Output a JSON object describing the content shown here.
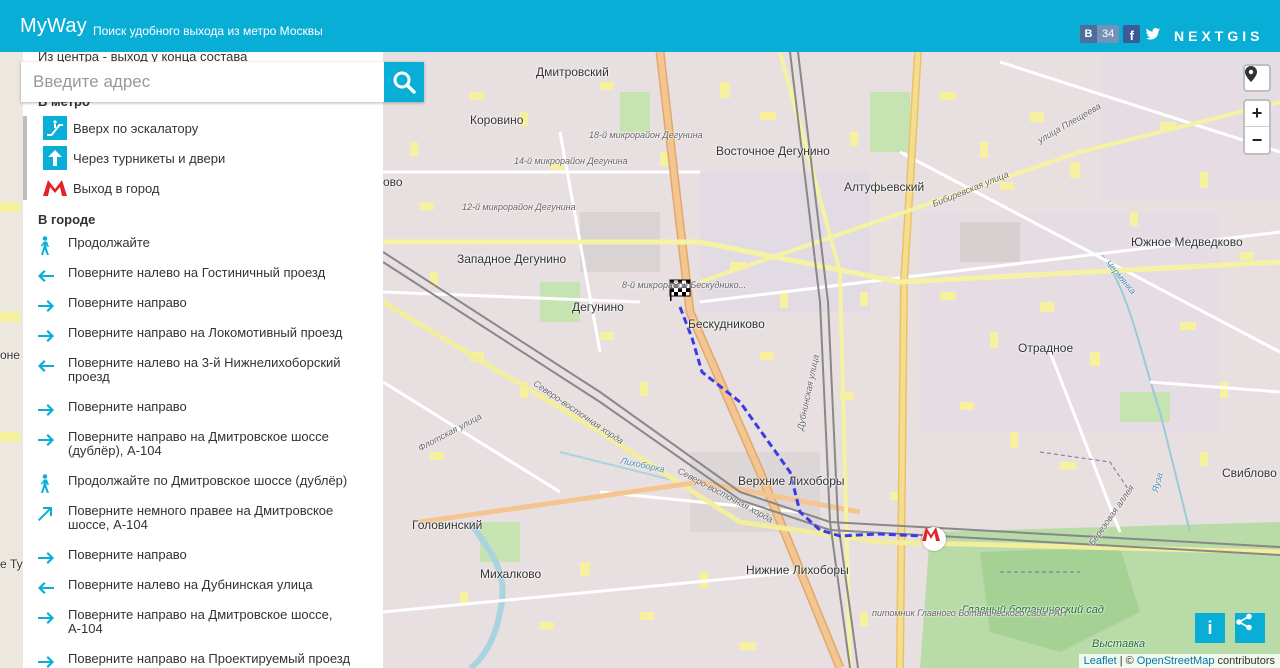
{
  "header": {
    "app_name": "MyWay",
    "tagline": "Поиск удобного выхода из метро Москвы",
    "vk_label": "В",
    "vk_count": "34",
    "fb_label": "f",
    "brand": "NEXTGIS"
  },
  "search": {
    "placeholder": "Введите адрес"
  },
  "sidebar": {
    "top_line": "Из центра - выход у конца состава",
    "metro_section_title": "В метро",
    "metro_steps": [
      {
        "label": "Вверх по эскалатору",
        "icon": "escalator-up-icon"
      },
      {
        "label": "Через турникеты и двери",
        "icon": "arrow-up-icon"
      },
      {
        "label": "Выход в город",
        "icon": "metro-logo-icon"
      }
    ],
    "city_section_title": "В городе",
    "city_steps": [
      {
        "label": "Продолжайте",
        "icon": "pedestrian-icon"
      },
      {
        "label": "Поверните налево на Гостиничный проезд",
        "icon": "arrow-left-icon"
      },
      {
        "label": "Поверните направо",
        "icon": "arrow-right-icon"
      },
      {
        "label": "Поверните направо на Локомотивный проезд",
        "icon": "arrow-right-icon"
      },
      {
        "label": "Поверните налево на 3-й Нижнелихоборский проезд",
        "icon": "arrow-left-icon"
      },
      {
        "label": "Поверните направо",
        "icon": "arrow-right-icon"
      },
      {
        "label": "Поверните направо на Дмитровское шоссе (дублёр), А-104",
        "icon": "arrow-right-icon"
      },
      {
        "label": "Продолжайте по Дмитровское шоссе (дублёр)",
        "icon": "pedestrian-icon"
      },
      {
        "label": "Поверните немного правее на Дмитровское шоссе, А-104",
        "icon": "arrow-slight-right-icon"
      },
      {
        "label": "Поверните направо",
        "icon": "arrow-right-icon"
      },
      {
        "label": "Поверните налево на Дубнинская улица",
        "icon": "arrow-left-icon"
      },
      {
        "label": "Поверните направо на Дмитровское шоссе, А-104",
        "icon": "arrow-right-icon"
      },
      {
        "label": "Поверните направо на Проектируемый проезд",
        "icon": "arrow-right-icon"
      }
    ]
  },
  "map": {
    "places": {
      "dmitrovsky": "Дмитровский",
      "korovino": "Коровино",
      "vost_degunino": "Восточное Дегунино",
      "altufevsky": "Алтуфьевский",
      "zap_degunino": "Западное Дегунино",
      "degunino": "Дегунино",
      "beskudnikovo": "Бескудниково",
      "yuzh_medvedkovo": "Южное Медведково",
      "otradnoe": "Отрадное",
      "verkh_likhobory": "Верхние Лихоборы",
      "golovinsky": "Головинский",
      "mikhalkovo": "Михалково",
      "nizh_likhobory": "Нижние Лихоборы",
      "sviblovo": "Свиблово",
      "mr18": "18-й микрорайон Дегунина",
      "mr14": "14-й микрорайон Дегунина",
      "mr12": "12-й микрорайон Дегунина",
      "mr8": "8-й микрорайон Бескуднико...",
      "bot_garden": "Главный ботанический сад",
      "pitomnik": "питомник Главного Ботанического сада РАН",
      "vystavka": "Выставка",
      "left_ovo": "ово",
      "left_one": "оне",
      "left_ty": "е Ту"
    },
    "streets": {
      "sev_vost_khorda": "Северо-восточная хорда",
      "sev_vost_khorda2": "Северо-восточная хорда",
      "flotskaya": "Флотская улица",
      "likhoborka": "Лихоборка",
      "dubninskaya": "Дубнинская улица",
      "bibirevskaya": "Бибиревская улица",
      "plescheeva": "улица Плещеева",
      "berezovaya": "Березовая аллея",
      "chermyanka": "Чермянка",
      "yauza": "Яуза"
    },
    "attribution": {
      "leaflet": "Leaflet",
      "sep": "| ©",
      "osm": "OpenStreetMap",
      "contrib": "contributors"
    },
    "info_btn": "i",
    "zoom_in": "+",
    "zoom_out": "−"
  },
  "colors": {
    "accent": "#09aed6",
    "route": "#3a3ae6",
    "metro_red": "#e4222a"
  }
}
